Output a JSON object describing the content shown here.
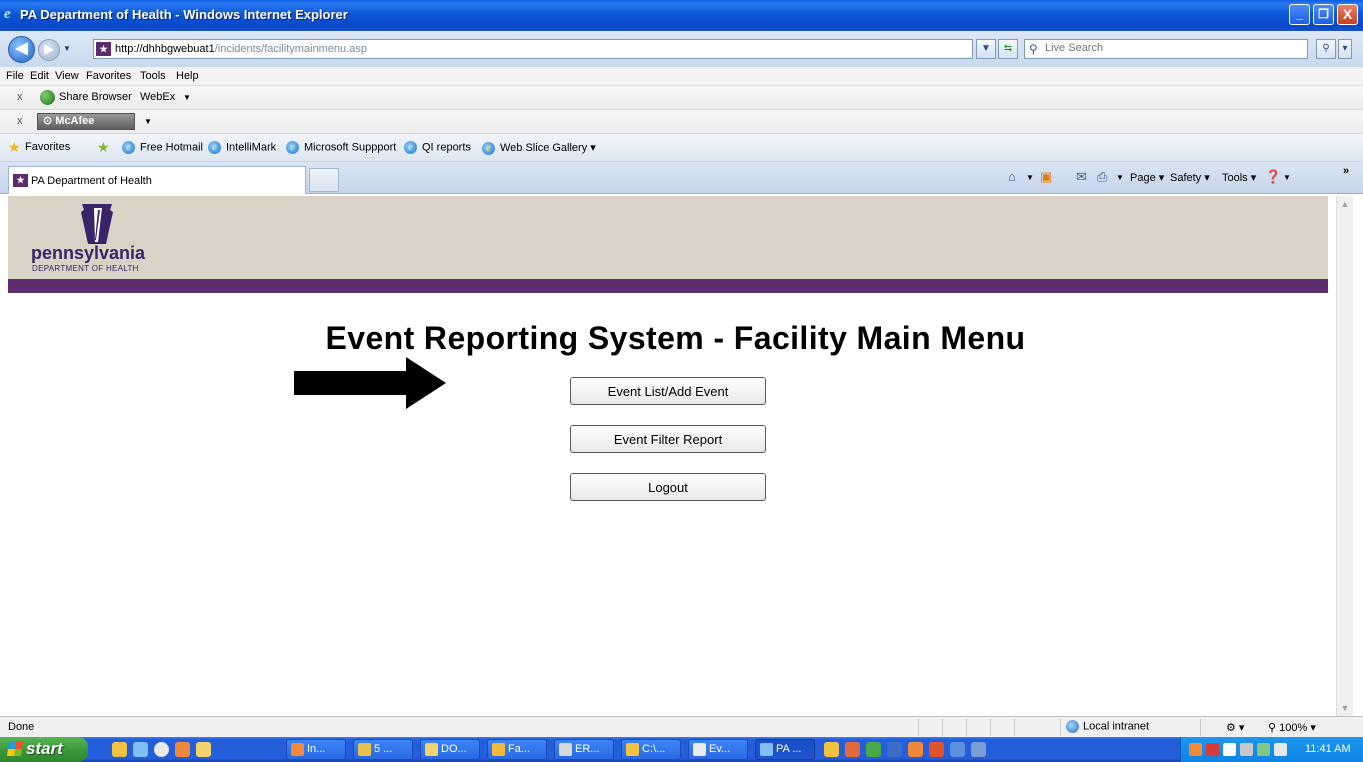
{
  "window": {
    "title": "PA Department of Health - Windows Internet Explorer",
    "minimize_glyph": "_",
    "restore_glyph": "❐",
    "close_glyph": "X"
  },
  "address": {
    "url_host": "http://dhhbgwebuat1",
    "url_path": "/incidents/facilitymainmenu.asp",
    "search_placeholder": "Live Search"
  },
  "menu": [
    "File",
    "Edit",
    "View",
    "Favorites",
    "Tools",
    "Help"
  ],
  "toolbars": {
    "share_browser": "Share Browser",
    "webex": "WebEx",
    "mcafee": "McAfee"
  },
  "favorites": {
    "label": "Favorites",
    "links": [
      "Free Hotmail",
      "IntelliMark",
      "Microsoft Suppport",
      "QI reports",
      "Web Slice Gallery"
    ]
  },
  "tabs": {
    "active_label": "PA Department of Health"
  },
  "commands": {
    "page": "Page",
    "safety": "Safety",
    "tools": "Tools",
    "chevron": "»"
  },
  "logo": {
    "word": "pennsylvania",
    "dept": "DEPARTMENT OF HEALTH"
  },
  "page": {
    "title": "Event Reporting System - Facility Main Menu",
    "buttons": [
      "Event List/Add Event",
      "Event Filter Report",
      "Logout"
    ]
  },
  "status": {
    "text": "Done",
    "zone": "Local intranet",
    "zoom": "100%"
  },
  "taskbar": {
    "start": "start",
    "tasks": [
      "In...",
      "5 ...",
      "DO...",
      "Fa...",
      "ER...",
      "C:\\...",
      "Ev...",
      "PA ..."
    ],
    "clock": "11:41 AM"
  },
  "colors": {
    "header_band": "#d8d3c6",
    "purple_band": "#5e2d6d",
    "logo_purple": "#3a2468"
  }
}
